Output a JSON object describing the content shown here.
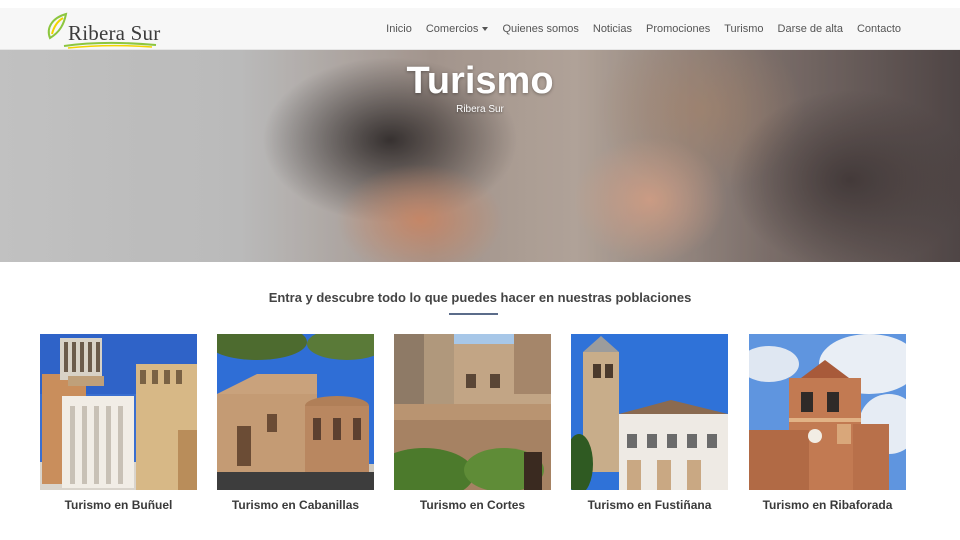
{
  "header": {
    "logo_text": "Ribera Sur",
    "nav": [
      {
        "label": "Inicio",
        "name": "nav-inicio",
        "dropdown": false
      },
      {
        "label": "Comercios",
        "name": "nav-comercios",
        "dropdown": true
      },
      {
        "label": "Quienes somos",
        "name": "nav-quienes-somos",
        "dropdown": false
      },
      {
        "label": "Noticias",
        "name": "nav-noticias",
        "dropdown": false
      },
      {
        "label": "Promociones",
        "name": "nav-promociones",
        "dropdown": false
      },
      {
        "label": "Turismo",
        "name": "nav-turismo",
        "dropdown": false
      },
      {
        "label": "Darse de alta",
        "name": "nav-darse-de-alta",
        "dropdown": false
      },
      {
        "label": "Contacto",
        "name": "nav-contacto",
        "dropdown": false
      }
    ]
  },
  "hero": {
    "title": "Turismo",
    "subtitle": "Ribera Sur"
  },
  "intro": {
    "text": "Entra y descubre todo lo que puedes hacer en nuestras poblaciones"
  },
  "cards": [
    {
      "label": "Turismo en Buñuel",
      "image": "bunuel-tower-photo"
    },
    {
      "label": "Turismo en Cabanillas",
      "image": "cabanillas-church-photo"
    },
    {
      "label": "Turismo en Cortes",
      "image": "cortes-castle-photo"
    },
    {
      "label": "Turismo en Fustiñana",
      "image": "fustinana-church-photo"
    },
    {
      "label": "Turismo en Ribaforada",
      "image": "ribaforada-belltower-photo"
    }
  ],
  "colors": {
    "accent_rule": "#5b6c8a",
    "logo_green": "#8cc63f",
    "logo_yellow": "#f2d400",
    "nav_bg": "#f7f7f7"
  }
}
